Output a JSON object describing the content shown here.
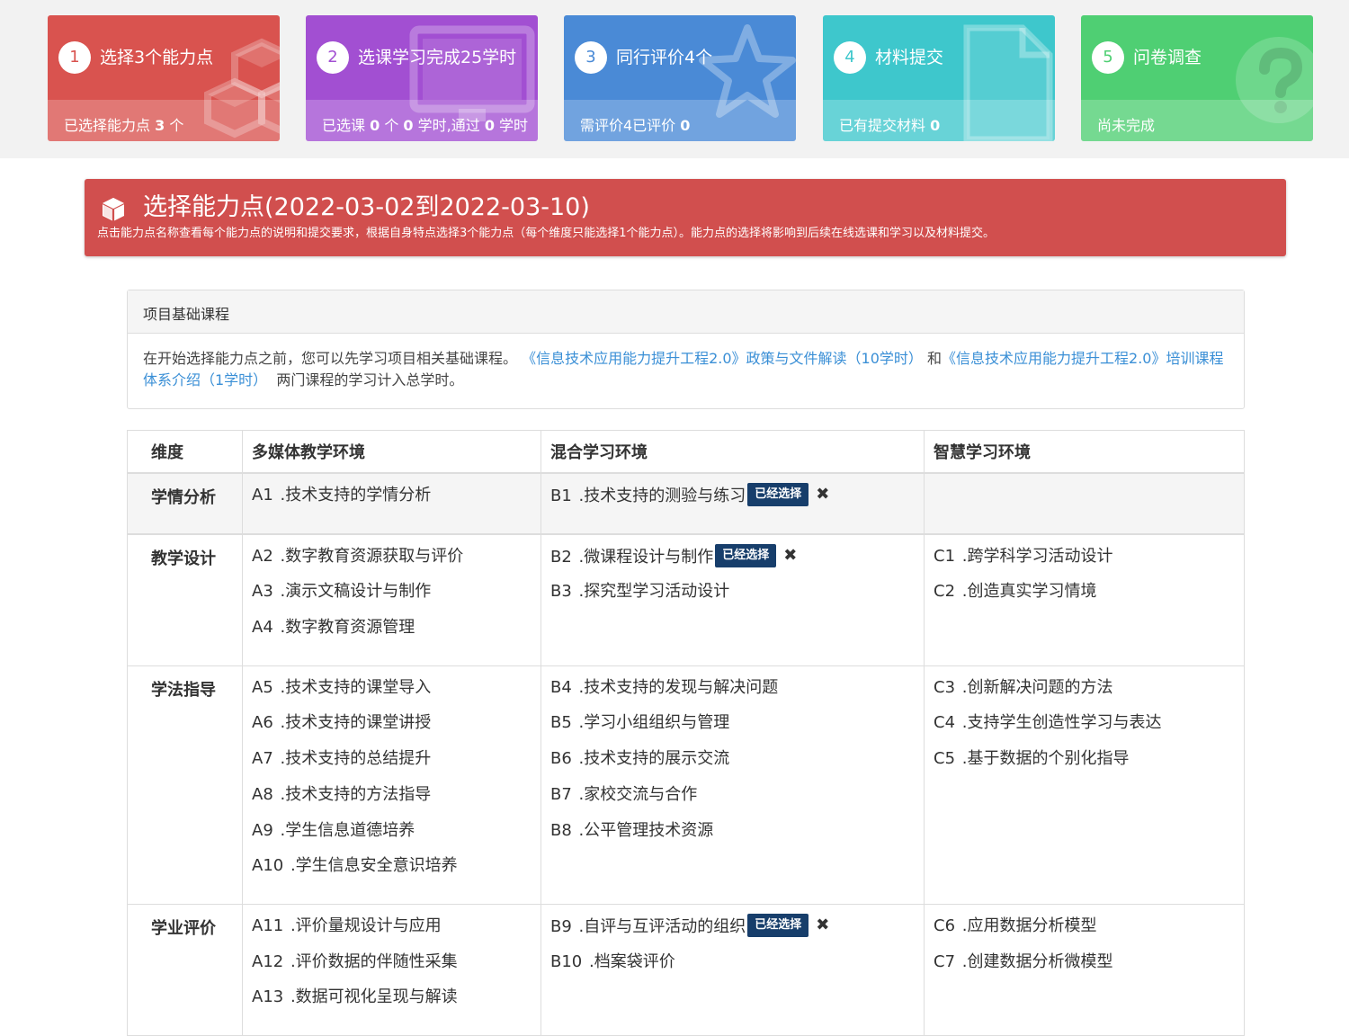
{
  "steps": [
    {
      "num": "1",
      "title": "选择3个能力点",
      "status_prefix": "已选择能力点 ",
      "status_value": "3",
      "status_suffix": " 个",
      "color": "#d9534f",
      "icon": "cubes-icon"
    },
    {
      "num": "2",
      "title": "选课学习完成25学时",
      "status_html_parts": [
        "已选课 ",
        "0",
        " 个 ",
        "0",
        " 学时,通过 ",
        "0",
        " 学时"
      ],
      "color": "#a24fd2",
      "icon": "monitor-icon"
    },
    {
      "num": "3",
      "title": "同行评价4个",
      "status_prefix": "需评价4已评价 ",
      "status_value": "0",
      "status_suffix": "",
      "color": "#4a8ad6",
      "icon": "star-icon"
    },
    {
      "num": "4",
      "title": "材料提交",
      "status_prefix": "已有提交材料 ",
      "status_value": "0",
      "status_suffix": "",
      "color": "#3ec7cc",
      "icon": "file-icon"
    },
    {
      "num": "5",
      "title": "问卷调查",
      "status_prefix": "尚未完成",
      "status_value": "",
      "status_suffix": "",
      "color": "#4fcf73",
      "icon": "question-icon"
    }
  ],
  "banner": {
    "title": "选择能力点(2022-03-02到2022-03-10)",
    "desc": "点击能力点名称查看每个能力点的说明和提交要求，根据自身特点选择3个能力点（每个维度只能选择1个能力点）。能力点的选择将影响到后续在线选课和学习以及材料提交。",
    "color": "#d14f4e"
  },
  "panel": {
    "heading": "项目基础课程",
    "text_before": "在开始选择能力点之前，您可以先学习项目相关基础课程。",
    "link1": "《信息技术应用能力提升工程2.0》政策与文件解读（10学时）",
    "joiner": " 和",
    "link2": "《信息技术应用能力提升工程2.0》培训课程体系介绍（1学时）",
    "text_after": "  两门课程的学习计入总学时。"
  },
  "table": {
    "headers": [
      "维度",
      "多媒体教学环境",
      "混合学习环境",
      "智慧学习环境"
    ],
    "badge_label": "已经选择",
    "rows": [
      {
        "dimension": "学情分析",
        "gray": true,
        "a": [
          {
            "code": "A1",
            "name": ".技术支持的学情分析"
          }
        ],
        "b": [
          {
            "code": "B1",
            "name": ".技术支持的测验与练习",
            "selected": true
          }
        ],
        "c": []
      },
      {
        "dimension": "教学设计",
        "gray": false,
        "a": [
          {
            "code": "A2",
            "name": ".数字教育资源获取与评价"
          },
          {
            "code": "A3",
            "name": ".演示文稿设计与制作"
          },
          {
            "code": "A4",
            "name": ".数字教育资源管理"
          }
        ],
        "b": [
          {
            "code": "B2",
            "name": ".微课程设计与制作",
            "selected": true
          },
          {
            "code": "B3",
            "name": ".探究型学习活动设计"
          }
        ],
        "c": [
          {
            "code": "C1",
            "name": ".跨学科学习活动设计"
          },
          {
            "code": "C2",
            "name": ".创造真实学习情境"
          }
        ]
      },
      {
        "dimension": "学法指导",
        "gray": false,
        "a": [
          {
            "code": "A5",
            "name": ".技术支持的课堂导入"
          },
          {
            "code": "A6",
            "name": ".技术支持的课堂讲授"
          },
          {
            "code": "A7",
            "name": ".技术支持的总结提升"
          },
          {
            "code": "A8",
            "name": ".技术支持的方法指导"
          },
          {
            "code": "A9",
            "name": ".学生信息道德培养"
          },
          {
            "code": "A10",
            "name": ".学生信息安全意识培养"
          }
        ],
        "b": [
          {
            "code": "B4",
            "name": ".技术支持的发现与解决问题"
          },
          {
            "code": "B5",
            "name": ".学习小组组织与管理"
          },
          {
            "code": "B6",
            "name": ".技术支持的展示交流"
          },
          {
            "code": "B7",
            "name": ".家校交流与合作"
          },
          {
            "code": "B8",
            "name": ".公平管理技术资源"
          }
        ],
        "c": [
          {
            "code": "C3",
            "name": ".创新解决问题的方法"
          },
          {
            "code": "C4",
            "name": ".支持学生创造性学习与表达"
          },
          {
            "code": "C5",
            "name": ".基于数据的个别化指导"
          }
        ]
      },
      {
        "dimension": "学业评价",
        "gray": false,
        "a": [
          {
            "code": "A11",
            "name": ".评价量规设计与应用"
          },
          {
            "code": "A12",
            "name": ".评价数据的伴随性采集"
          },
          {
            "code": "A13",
            "name": ".数据可视化呈现与解读"
          }
        ],
        "b": [
          {
            "code": "B9",
            "name": ".自评与互评活动的组织",
            "selected": true
          },
          {
            "code": "B10",
            "name": ".档案袋评价"
          }
        ],
        "c": [
          {
            "code": "C6",
            "name": ".应用数据分析模型"
          },
          {
            "code": "C7",
            "name": ".创建数据分析微模型"
          }
        ]
      }
    ]
  }
}
